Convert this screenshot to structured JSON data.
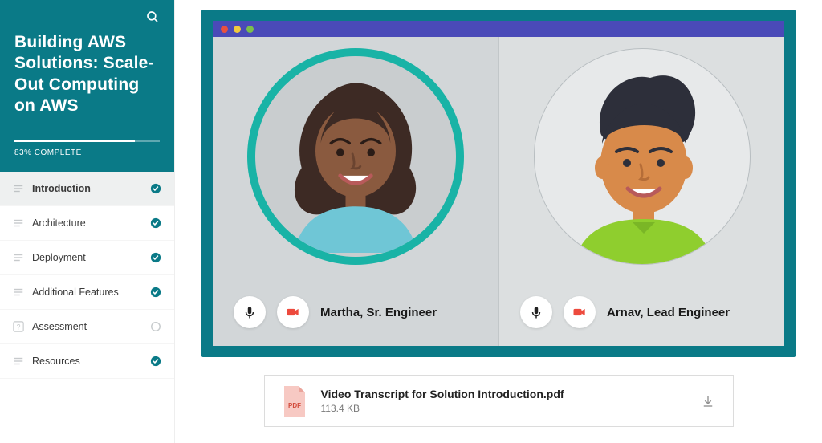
{
  "course": {
    "title": "Building AWS Solutions: Scale-Out Computing on AWS",
    "progress_percent": 83,
    "progress_label": "83% COMPLETE"
  },
  "nav": {
    "items": [
      {
        "label": "Introduction",
        "icon": "list",
        "status": "complete",
        "active": true
      },
      {
        "label": "Architecture",
        "icon": "list",
        "status": "complete",
        "active": false
      },
      {
        "label": "Deployment",
        "icon": "list",
        "status": "complete",
        "active": false
      },
      {
        "label": "Additional Features",
        "icon": "list",
        "status": "complete",
        "active": false
      },
      {
        "label": "Assessment",
        "icon": "question",
        "status": "incomplete",
        "active": false
      },
      {
        "label": "Resources",
        "icon": "list",
        "status": "complete",
        "active": false
      }
    ]
  },
  "video": {
    "traffic_dots": [
      "#e8513f",
      "#f0c93e",
      "#7bbf4b"
    ],
    "people": [
      {
        "label": "Martha, Sr. Engineer"
      },
      {
        "label": "Arnav, Lead Engineer"
      }
    ]
  },
  "attachment": {
    "name": "Video Transcript for Solution Introduction.pdf",
    "size": "113.4 KB",
    "badge": "PDF"
  },
  "colors": {
    "brand": "#0a7a87",
    "accent": "#19b3a6",
    "titlebar": "#4a4ab8",
    "camera": "#ed4a3d"
  }
}
